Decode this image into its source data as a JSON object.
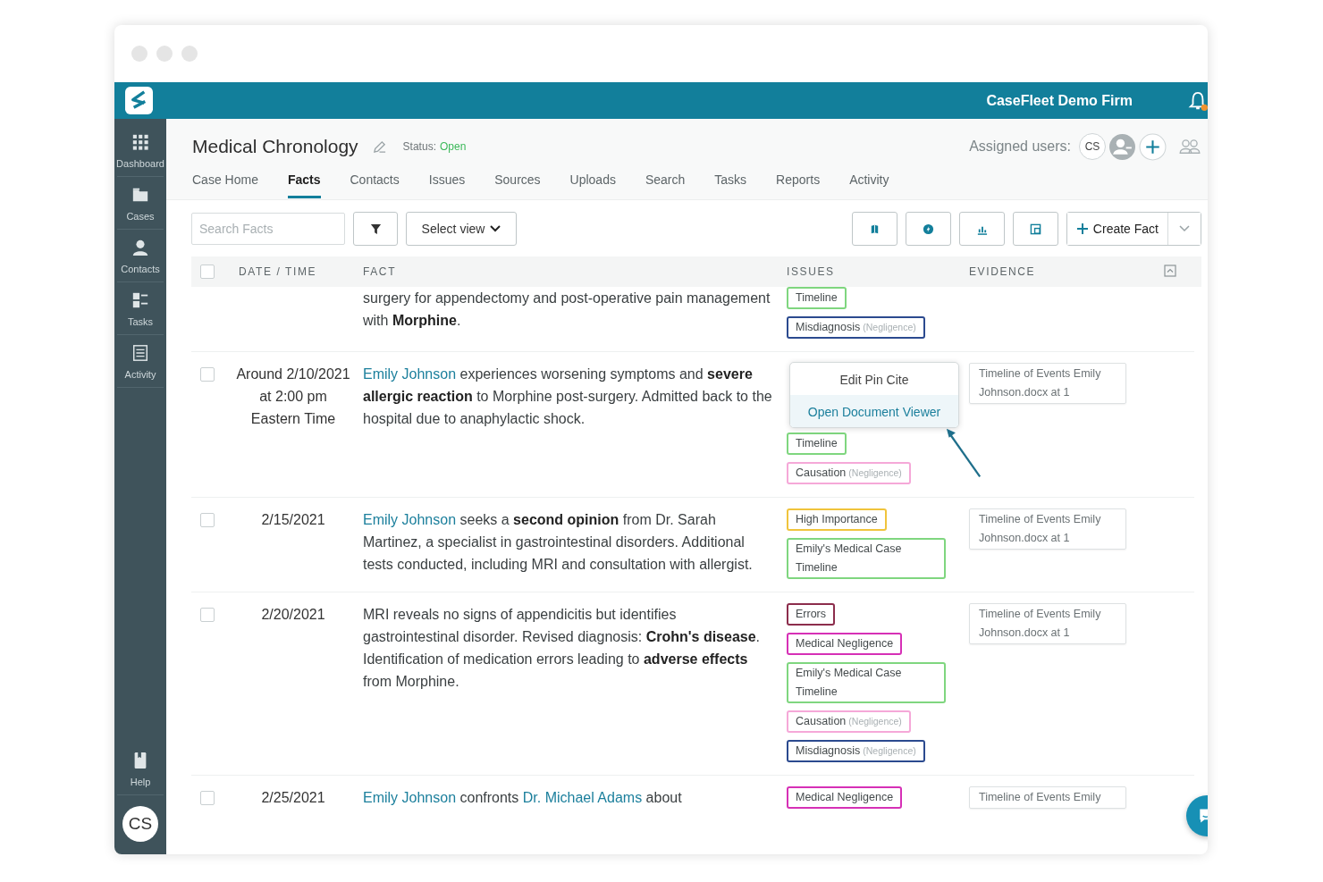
{
  "app": {
    "firm": "CaseFleet Demo Firm"
  },
  "sidebar": {
    "items": [
      {
        "label": "Dashboard"
      },
      {
        "label": "Cases"
      },
      {
        "label": "Contacts"
      },
      {
        "label": "Tasks"
      },
      {
        "label": "Activity"
      }
    ],
    "help": "Help",
    "avatar": "CS"
  },
  "case": {
    "title": "Medical Chronology",
    "status_label": "Status:",
    "status": "Open",
    "assigned_label": "Assigned users:",
    "assigned_initials": "CS"
  },
  "tabs": [
    {
      "label": "Case Home",
      "selected": false
    },
    {
      "label": "Facts",
      "selected": true
    },
    {
      "label": "Contacts",
      "selected": false
    },
    {
      "label": "Issues",
      "selected": false
    },
    {
      "label": "Sources",
      "selected": false
    },
    {
      "label": "Uploads",
      "selected": false
    },
    {
      "label": "Search",
      "selected": false
    },
    {
      "label": "Tasks",
      "selected": false
    },
    {
      "label": "Reports",
      "selected": false
    },
    {
      "label": "Activity",
      "selected": false
    }
  ],
  "toolbar": {
    "search_placeholder": "Search Facts",
    "view": "Select view",
    "create": "Create Fact"
  },
  "table": {
    "all_checked": false,
    "columns": [
      "DATE / TIME",
      "FACT",
      "ISSUES",
      "EVIDENCE"
    ],
    "rows": [
      {
        "checked": null,
        "date": "",
        "fact": [
          {
            "kind": "text",
            "text": "surgery for appendectomy and post-operative pain management with **Morphine**."
          }
        ],
        "issues": [
          {
            "label": "Timeline",
            "color": "#7fd67f"
          },
          {
            "label": "Misdiagnosis",
            "qualifier": "(Negligence)",
            "color": "#2b4a8f"
          }
        ],
        "evidence": []
      },
      {
        "checked": false,
        "date": "Around 2/10/2021 at 2:00 pm Eastern Time",
        "fact": [
          {
            "kind": "link",
            "text": "Emily Johnson"
          },
          {
            "kind": "text",
            "text": " experiences worsening symptoms and **severe allergic reaction** to Morphine post-surgery. Admitted back to the hospital due to anaphylactic shock."
          }
        ],
        "menu": [
          {
            "label": "Edit Pin Cite",
            "selected": false
          },
          {
            "label": "Open Document Viewer",
            "selected": true
          }
        ],
        "issues": [
          {
            "label": "Timeline",
            "color": "#7fd67f"
          },
          {
            "label": "Causation",
            "qualifier": "(Negligence)",
            "color": "#f5a8d8"
          }
        ],
        "evidence": [
          "Timeline of Events Emily Johnson.docx at 1"
        ]
      },
      {
        "checked": false,
        "date": "2/15/2021",
        "fact": [
          {
            "kind": "link",
            "text": "Emily Johnson"
          },
          {
            "kind": "text",
            "text": " seeks a **second opinion** from Dr. Sarah Martinez, a specialist in gastrointestinal disorders. Additional tests conducted, including MRI and consultation with allergist."
          }
        ],
        "issues": [
          {
            "label": "High Importance",
            "color": "#f0c43c"
          },
          {
            "label": "Emily's Medical Case Timeline",
            "color": "#7fd67f"
          }
        ],
        "evidence": [
          "Timeline of Events Emily Johnson.docx at 1"
        ]
      },
      {
        "checked": false,
        "date": "2/20/2021",
        "fact": [
          {
            "kind": "text",
            "text": "MRI reveals no signs of appendicitis but identifies gastrointestinal disorder. Revised diagnosis: **Crohn's disease**. Identification of medication errors leading to **adverse effects** from Morphine."
          }
        ],
        "issues": [
          {
            "label": "Errors",
            "color": "#8c2d4c"
          },
          {
            "label": "Medical Negligence",
            "color": "#d630b6"
          },
          {
            "label": "Emily's Medical Case Timeline",
            "color": "#7fd67f"
          },
          {
            "label": "Causation",
            "qualifier": "(Negligence)",
            "color": "#f5a8d8"
          },
          {
            "label": "Misdiagnosis",
            "qualifier": "(Negligence)",
            "color": "#2b4a8f"
          }
        ],
        "evidence": [
          "Timeline of Events Emily Johnson.docx at 1"
        ]
      },
      {
        "checked": false,
        "date": "2/25/2021",
        "fact": [
          {
            "kind": "link",
            "text": "Emily Johnson"
          },
          {
            "kind": "text",
            "text": " confronts "
          },
          {
            "kind": "link",
            "text": "Dr. Michael Adams"
          },
          {
            "kind": "text",
            "text": " about"
          }
        ],
        "issues": [
          {
            "label": "Medical Negligence",
            "color": "#d630b6"
          }
        ],
        "evidence": [
          "Timeline of Events Emily"
        ]
      }
    ]
  }
}
